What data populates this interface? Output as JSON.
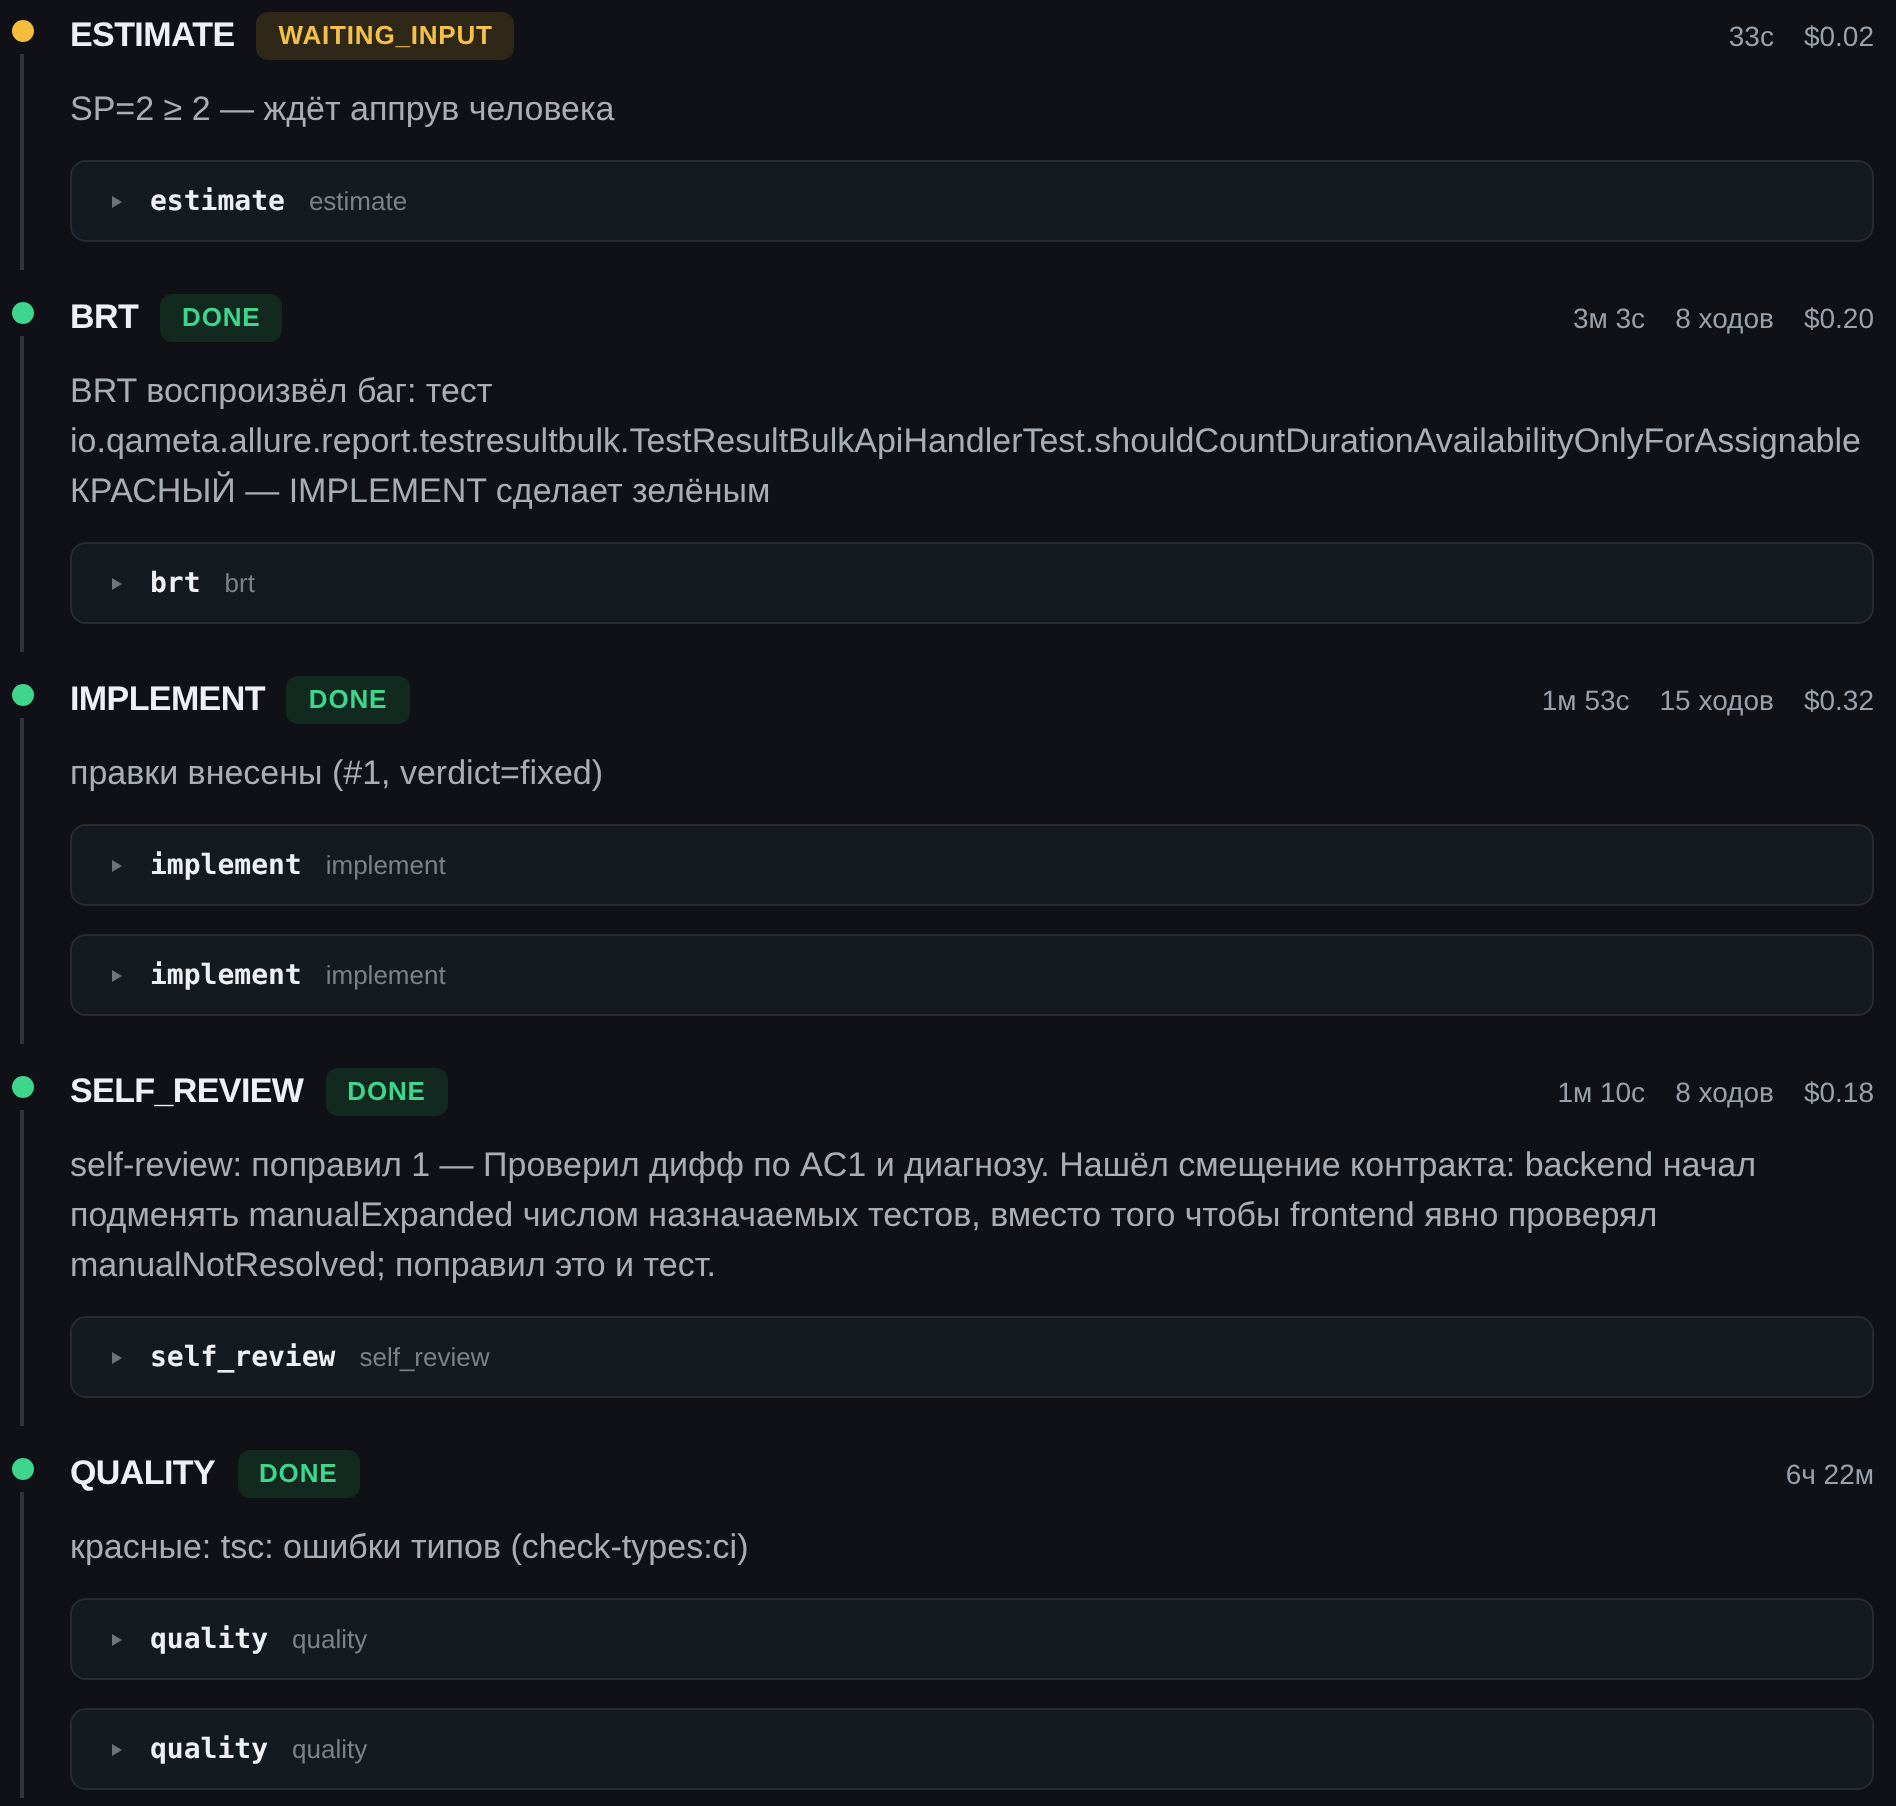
{
  "stages": [
    {
      "kind": "waiting",
      "name": "ESTIMATE",
      "status": "WAITING_INPUT",
      "meta": [
        "33с",
        "$0.02"
      ],
      "description": "SP=2 ≥ 2 — ждёт аппрув человека",
      "steps": [
        {
          "title": "estimate",
          "subtitle": "estimate",
          "expanded": false
        }
      ]
    },
    {
      "kind": "done",
      "name": "BRT",
      "status": "DONE",
      "meta": [
        "3м 3с",
        "8 ходов",
        "$0.20"
      ],
      "description": "BRT воспроизвёл баг: тест io.qameta.allure.report.testresultbulk.TestResultBulkApiHandlerTest.shouldCountDurationAvailabilityOnlyForAssignable КРАСНЫЙ — IMPLEMENT сделает зелёным",
      "steps": [
        {
          "title": "brt",
          "subtitle": "brt",
          "expanded": false
        }
      ]
    },
    {
      "kind": "done",
      "name": "IMPLEMENT",
      "status": "DONE",
      "meta": [
        "1м 53с",
        "15 ходов",
        "$0.32"
      ],
      "description": "правки внесены (#1, verdict=fixed)",
      "steps": [
        {
          "title": "implement",
          "subtitle": "implement",
          "expanded": false
        },
        {
          "title": "implement",
          "subtitle": "implement",
          "expanded": false
        }
      ]
    },
    {
      "kind": "done",
      "name": "SELF_REVIEW",
      "status": "DONE",
      "meta": [
        "1м 10с",
        "8 ходов",
        "$0.18"
      ],
      "description": "self-review: поправил 1 — Проверил дифф по AC1 и диагнозу. Нашёл смещение контракта: backend начал подменять manualExpanded числом назначаемых тестов, вместо того чтобы frontend явно проверял manualNotResolved; поправил это и тест.",
      "steps": [
        {
          "title": "self_review",
          "subtitle": "self_review",
          "expanded": false
        }
      ]
    },
    {
      "kind": "done",
      "name": "QUALITY",
      "status": "DONE",
      "meta": [
        "6ч 22м"
      ],
      "description": "красные: tsc: ошибки типов (check-types:ci)",
      "steps": [
        {
          "title": "quality",
          "subtitle": "quality",
          "expanded": false
        },
        {
          "title": "quality",
          "subtitle": "quality",
          "expanded": false
        }
      ]
    }
  ]
}
